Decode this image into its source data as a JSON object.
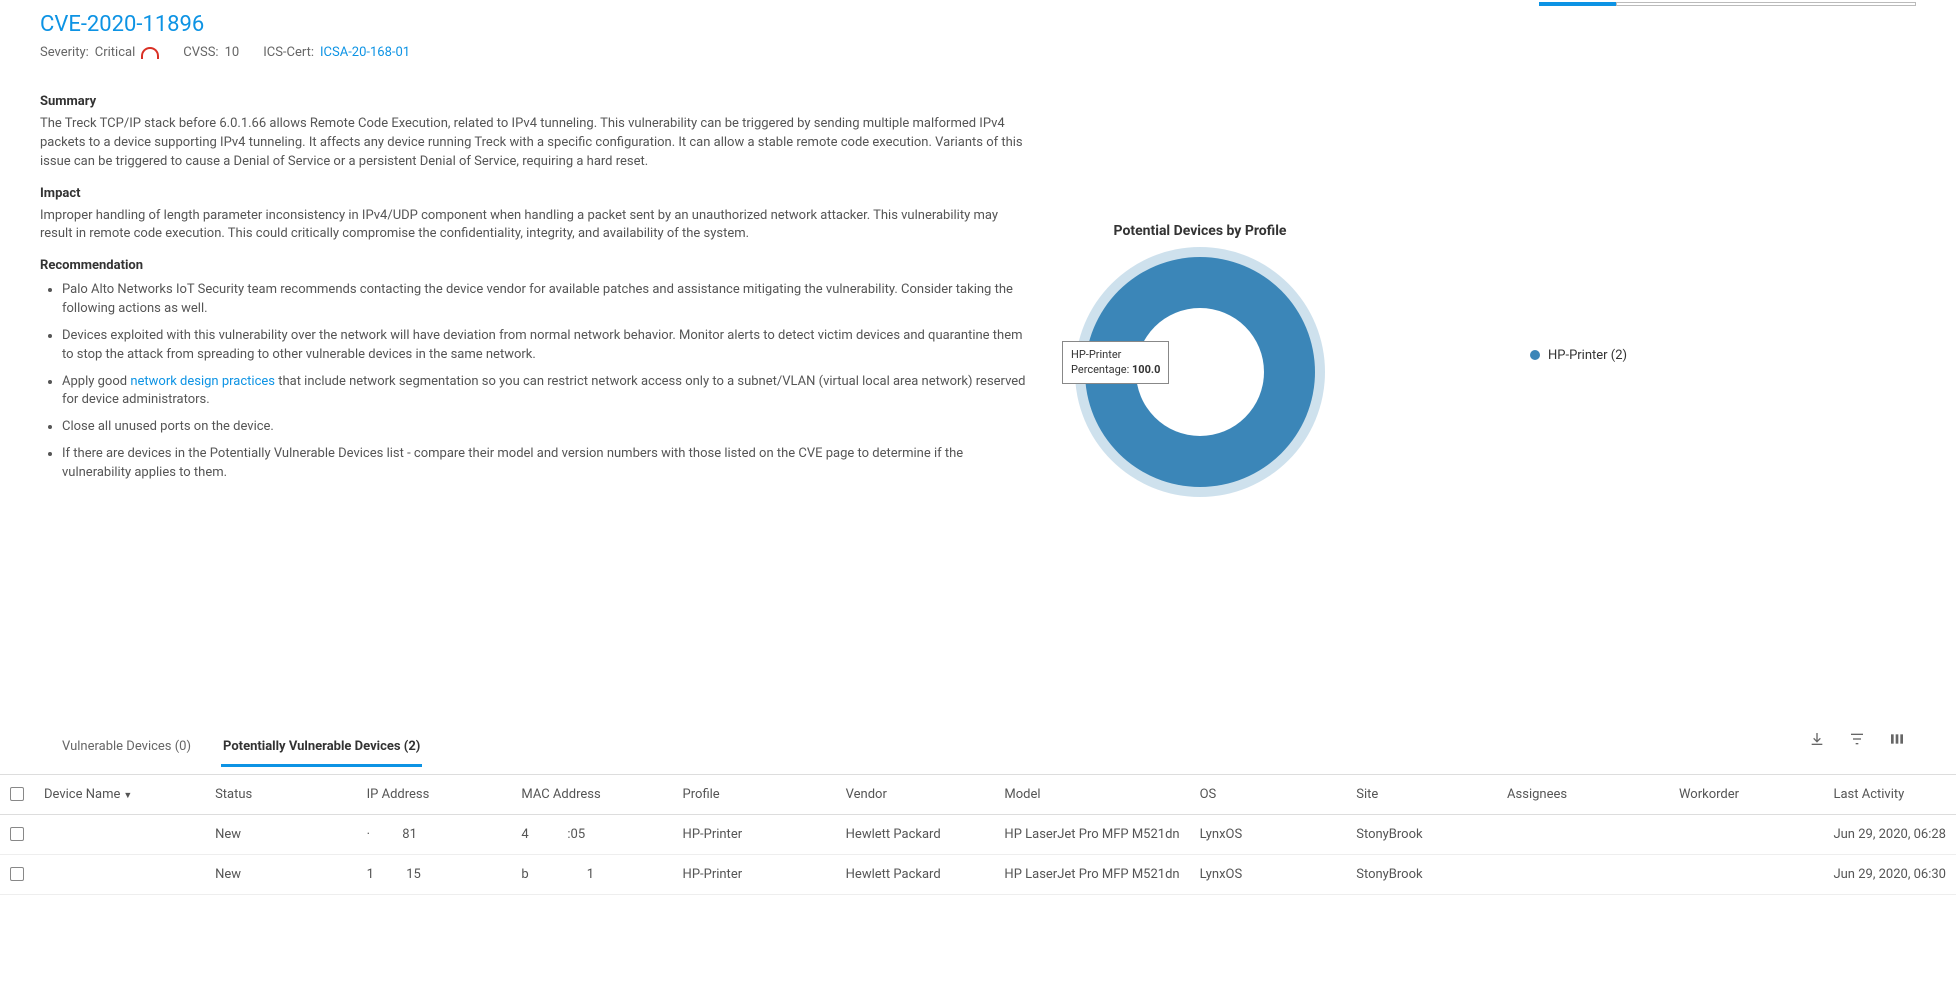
{
  "cve": {
    "id": "CVE-2020-11896",
    "severity_label": "Severity:",
    "severity_value": "Critical",
    "cvss_label": "CVSS:",
    "cvss_value": "10",
    "ics_label": "ICS-Cert:",
    "ics_link_text": "ICSA-20-168-01"
  },
  "sections": {
    "summary_h": "Summary",
    "summary_p": "The Treck TCP/IP stack before 6.0.1.66 allows Remote Code Execution, related to IPv4 tunneling. This vulnerability can be triggered by sending multiple malformed IPv4 packets to a device supporting IPv4 tunneling. It affects any device running Treck with a specific configuration. It can allow a stable remote code execution. Variants of this issue can be triggered to cause a Denial of Service or a persistent Denial of Service, requiring a hard reset.",
    "impact_h": "Impact",
    "impact_p": "Improper handling of length parameter inconsistency in IPv4/UDP component when handling a packet sent by an unauthorized network attacker. This vulnerability may result in remote code execution. This could critically compromise the confidentiality, integrity, and availability of the system.",
    "rec_h": "Recommendation",
    "rec_items": [
      {
        "pre": "Palo Alto Networks IoT Security team recommends contacting the device vendor for available patches and assistance mitigating the vulnerability. Consider taking the following actions as well.",
        "link": "",
        "post": ""
      },
      {
        "pre": "Devices exploited with this vulnerability over the network will have deviation from normal network behavior. Monitor alerts to detect victim devices and quarantine them to stop the attack from spreading to other vulnerable devices in the same network.",
        "link": "",
        "post": ""
      },
      {
        "pre": "Apply good ",
        "link": "network design practices",
        "post": " that include network segmentation so you can restrict network access only to a subnet/VLAN (virtual local area network) reserved for device administrators."
      },
      {
        "pre": "Close all unused ports on the device.",
        "link": "",
        "post": ""
      },
      {
        "pre": "If there are devices in the Potentially Vulnerable Devices list - compare their model and version numbers with those listed on the CVE page to determine if the vulnerability applies to them.",
        "link": "",
        "post": ""
      }
    ]
  },
  "chart_data": {
    "type": "pie",
    "title": "Potential Devices by Profile",
    "series": [
      {
        "name": "HP-Printer",
        "value": 2,
        "percentage": 100.0,
        "color": "#3b86b8"
      }
    ],
    "tooltip": {
      "name": "HP-Printer",
      "pct_label": "Percentage:",
      "pct_value": "100.0"
    },
    "legend": [
      {
        "label": "HP-Printer (2)"
      }
    ]
  },
  "tabs": {
    "vuln": "Vulnerable Devices (0)",
    "pot": "Potentially Vulnerable Devices (2)"
  },
  "table": {
    "headers": {
      "device_name": "Device Name",
      "status": "Status",
      "ip": "IP Address",
      "mac": "MAC Address",
      "profile": "Profile",
      "vendor": "Vendor",
      "model": "Model",
      "os": "OS",
      "site": "Site",
      "assignees": "Assignees",
      "workorder": "Workorder",
      "last": "Last Activity"
    },
    "rows": [
      {
        "device_name": "",
        "status": "New",
        "ip_a": "·",
        "ip_b": "81",
        "mac_a": "4",
        "mac_b": ":05",
        "profile": "HP-Printer",
        "vendor": "Hewlett Packard",
        "model": "HP LaserJet Pro MFP M521dn",
        "os": "LynxOS",
        "site": "StonyBrook",
        "assignees": "",
        "workorder": "",
        "last": "Jun 29, 2020, 06:28"
      },
      {
        "device_name": "",
        "status": "New",
        "ip_a": "1",
        "ip_b": "15",
        "mac_a": "b",
        "mac_b": "1",
        "profile": "HP-Printer",
        "vendor": "Hewlett Packard",
        "model": "HP LaserJet Pro MFP M521dn",
        "os": "LynxOS",
        "site": "StonyBrook",
        "assignees": "",
        "workorder": "",
        "last": "Jun 29, 2020, 06:30"
      }
    ]
  }
}
